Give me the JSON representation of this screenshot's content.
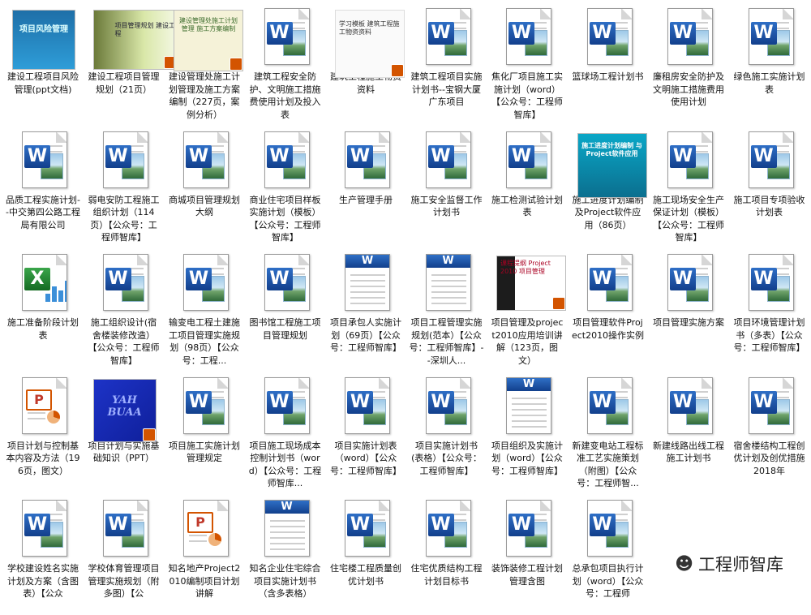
{
  "watermark": {
    "icon": "wechat-icon",
    "text": "工程师智库"
  },
  "items": [
    {
      "label": "建设工程项目风险管理(ppt文档)",
      "icon": "thumb",
      "thumb": "t1",
      "ttext": "项目风险管理",
      "ppt": false
    },
    {
      "label": "建设工程项目管理规划（21页）",
      "icon": "thumb",
      "thumb": "t2",
      "ttext": "项目管理规划 建设工程",
      "ppt": true
    },
    {
      "label": "建设管理处施工计划管理及施工方案编制（227页，案例分析）",
      "icon": "thumb",
      "thumb": "t3",
      "ttext": "建设管理处施工计划管理 施工方案编制",
      "ppt": true
    },
    {
      "label": "建筑工程安全防护、文明施工措施费使用计划及投入表",
      "icon": "word"
    },
    {
      "label": "建筑工程施工物资资料",
      "icon": "thumb",
      "thumb": "t4",
      "ttext": "学习模板 建筑工程施工物资资料",
      "ppt": true
    },
    {
      "label": "建筑工程项目实施计划书--宝钢大厦广东项目",
      "icon": "word"
    },
    {
      "label": "焦化厂项目施工实施计划（word）【公众号：工程师智库】",
      "icon": "word"
    },
    {
      "label": "篮球场工程计划书",
      "icon": "word"
    },
    {
      "label": "廉租房安全防护及文明施工措施费用使用计划",
      "icon": "word"
    },
    {
      "label": "绿色施工实施计划表",
      "icon": "word"
    },
    {
      "label": "品质工程实施计划--中交第四公路工程局有限公司",
      "icon": "word"
    },
    {
      "label": "弱电安防工程施工组织计划（114页）【公众号：工程师智库】",
      "icon": "word"
    },
    {
      "label": "商城项目管理规划大纲",
      "icon": "word"
    },
    {
      "label": "商业住宅项目样板实施计划（模板）【公众号：工程师智库】",
      "icon": "word"
    },
    {
      "label": "生产管理手册",
      "icon": "word"
    },
    {
      "label": "施工安全监督工作计划书",
      "icon": "word"
    },
    {
      "label": "施工检测试验计划表",
      "icon": "word"
    },
    {
      "label": "施工进度计划编制及Project软件应用（86页）",
      "icon": "thumb",
      "thumb": "t5",
      "ttext": "施工进度计划编制 与Project软件应用",
      "ppt": false
    },
    {
      "label": "施工现场安全生产保证计划（模板）【公众号：工程师智库】",
      "icon": "word"
    },
    {
      "label": "施工项目专项验收计划表",
      "icon": "word"
    },
    {
      "label": "施工准备阶段计划表",
      "icon": "excel"
    },
    {
      "label": "施工组织设计(宿舍楼装修改造）【公众号：工程师智库】",
      "icon": "word"
    },
    {
      "label": "输变电工程土建施工项目管理实施规划（98页）【公众号：工程...",
      "icon": "word"
    },
    {
      "label": "图书馆工程施工项目管理规划",
      "icon": "word"
    },
    {
      "label": "项目承包人实施计划（69页）【公众号：工程师智库】",
      "icon": "oldword"
    },
    {
      "label": "项目工程管理实施规划(范本）【公众号：工程师智库】--深圳人...",
      "icon": "oldword"
    },
    {
      "label": "项目管理及project2010应用培训讲解（123页，图文）",
      "icon": "thumb",
      "thumb": "t6",
      "ttext": "课程提纲 Project 2010 项目管理",
      "ppt": true
    },
    {
      "label": "项目管理软件Project2010操作实例",
      "icon": "word"
    },
    {
      "label": "项目管理实施方案",
      "icon": "word"
    },
    {
      "label": "项目环境管理计划书（多表）【公众号：工程师智库】",
      "icon": "word"
    },
    {
      "label": "项目计划与控制基本内容及方法（196页，图文）",
      "icon": "ppt"
    },
    {
      "label": "项目计划与实施基础知识（PPT）",
      "icon": "thumb",
      "thumb": "t7",
      "ttext": "YAH BUAA",
      "ppt": true
    },
    {
      "label": "项目施工实施计划管理规定",
      "icon": "word"
    },
    {
      "label": "项目施工现场成本控制计划书（word）【公众号：工程师智库...",
      "icon": "word"
    },
    {
      "label": "项目实施计划表（word）【公众号：工程师智库】",
      "icon": "word"
    },
    {
      "label": "项目实施计划书(表格）【公众号：工程师智库】",
      "icon": "word"
    },
    {
      "label": "项目组织及实施计划（word）【公众号：工程师智库】",
      "icon": "oldword"
    },
    {
      "label": "新建变电站工程标准工艺实施策划（附图）【公众号：工程师智...",
      "icon": "word"
    },
    {
      "label": "新建线路出线工程施工计划书",
      "icon": "word"
    },
    {
      "label": "宿舍楼结构工程创优计划及创优措施2018年",
      "icon": "word"
    },
    {
      "label": "学校建设姓名实施计划及方案（含图表）【公众",
      "icon": "word"
    },
    {
      "label": "学校体育管理项目管理实施规划（附多图）【公",
      "icon": "word"
    },
    {
      "label": "知名地产Project2010编制项目计划讲解",
      "icon": "ppt"
    },
    {
      "label": "知名企业住宅综合项目实施计划书（含多表格）",
      "icon": "oldword"
    },
    {
      "label": "住宅楼工程质量创优计划书",
      "icon": "word"
    },
    {
      "label": "住宅优质结构工程计划目标书",
      "icon": "word"
    },
    {
      "label": "装饰装修工程计划管理含图",
      "icon": "word"
    },
    {
      "label": "总承包项目执行计划（word）【公众号：工程师",
      "icon": "word"
    }
  ]
}
